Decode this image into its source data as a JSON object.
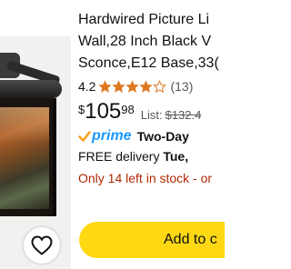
{
  "product": {
    "title_lines": [
      "Hardwired Picture Li",
      "Wall,28 Inch Black V",
      "Sconce,E12 Base,33("
    ],
    "rating": "4.2",
    "rating_stars": 4.2,
    "review_count": "(13)",
    "price": {
      "symbol": "$",
      "whole": "105",
      "fraction": "98",
      "list_label": "List:",
      "list_price": "$132.4"
    },
    "prime": {
      "label": "prime",
      "speed": "Two-Day"
    },
    "delivery": {
      "text": "FREE delivery ",
      "date": "Tue,"
    },
    "stock": "Only 14 left in stock - or"
  },
  "actions": {
    "add_to_cart": "Add to c",
    "favorite_icon": "heart-outline-icon"
  },
  "colors": {
    "star": "#de7921",
    "prime_blue": "#1a98ff",
    "stock_red": "#b12704",
    "button_yellow": "#ffd814"
  }
}
